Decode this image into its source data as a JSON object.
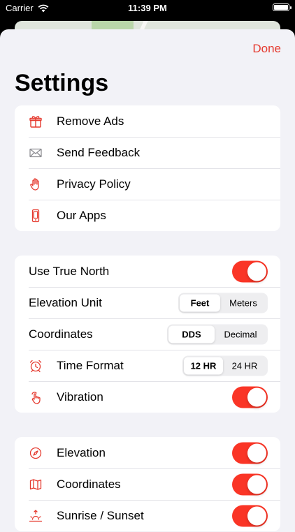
{
  "status_bar": {
    "carrier": "Carrier",
    "time": "11:39 PM"
  },
  "header": {
    "done_label": "Done",
    "title": "Settings"
  },
  "general": [
    {
      "label": "Remove Ads",
      "icon": "gift-icon"
    },
    {
      "label": "Send Feedback",
      "icon": "envelope-icon"
    },
    {
      "label": "Privacy Policy",
      "icon": "hand-icon"
    },
    {
      "label": "Our Apps",
      "icon": "phone-icon"
    }
  ],
  "preferences": {
    "true_north": {
      "label": "Use True North",
      "on": true
    },
    "elevation_unit": {
      "label": "Elevation Unit",
      "options": [
        "Feet",
        "Meters"
      ],
      "selected": "Feet"
    },
    "coordinates": {
      "label": "Coordinates",
      "options": [
        "DDS",
        "Decimal"
      ],
      "selected": "DDS"
    },
    "time_format": {
      "label": "Time Format",
      "icon": "alarm-clock-icon",
      "options": [
        "12 HR",
        "24 HR"
      ],
      "selected": "12 HR"
    },
    "vibration": {
      "label": "Vibration",
      "icon": "tap-icon",
      "on": true
    }
  },
  "display": [
    {
      "label": "Elevation",
      "icon": "compass-icon",
      "on": true
    },
    {
      "label": "Coordinates",
      "icon": "map-icon",
      "on": true
    },
    {
      "label": "Sunrise / Sunset",
      "icon": "sunrise-icon",
      "on": true
    }
  ],
  "colors": {
    "accent": "#e53a2f",
    "toggle_on": "#fa3526",
    "background": "#f2f2f7"
  }
}
